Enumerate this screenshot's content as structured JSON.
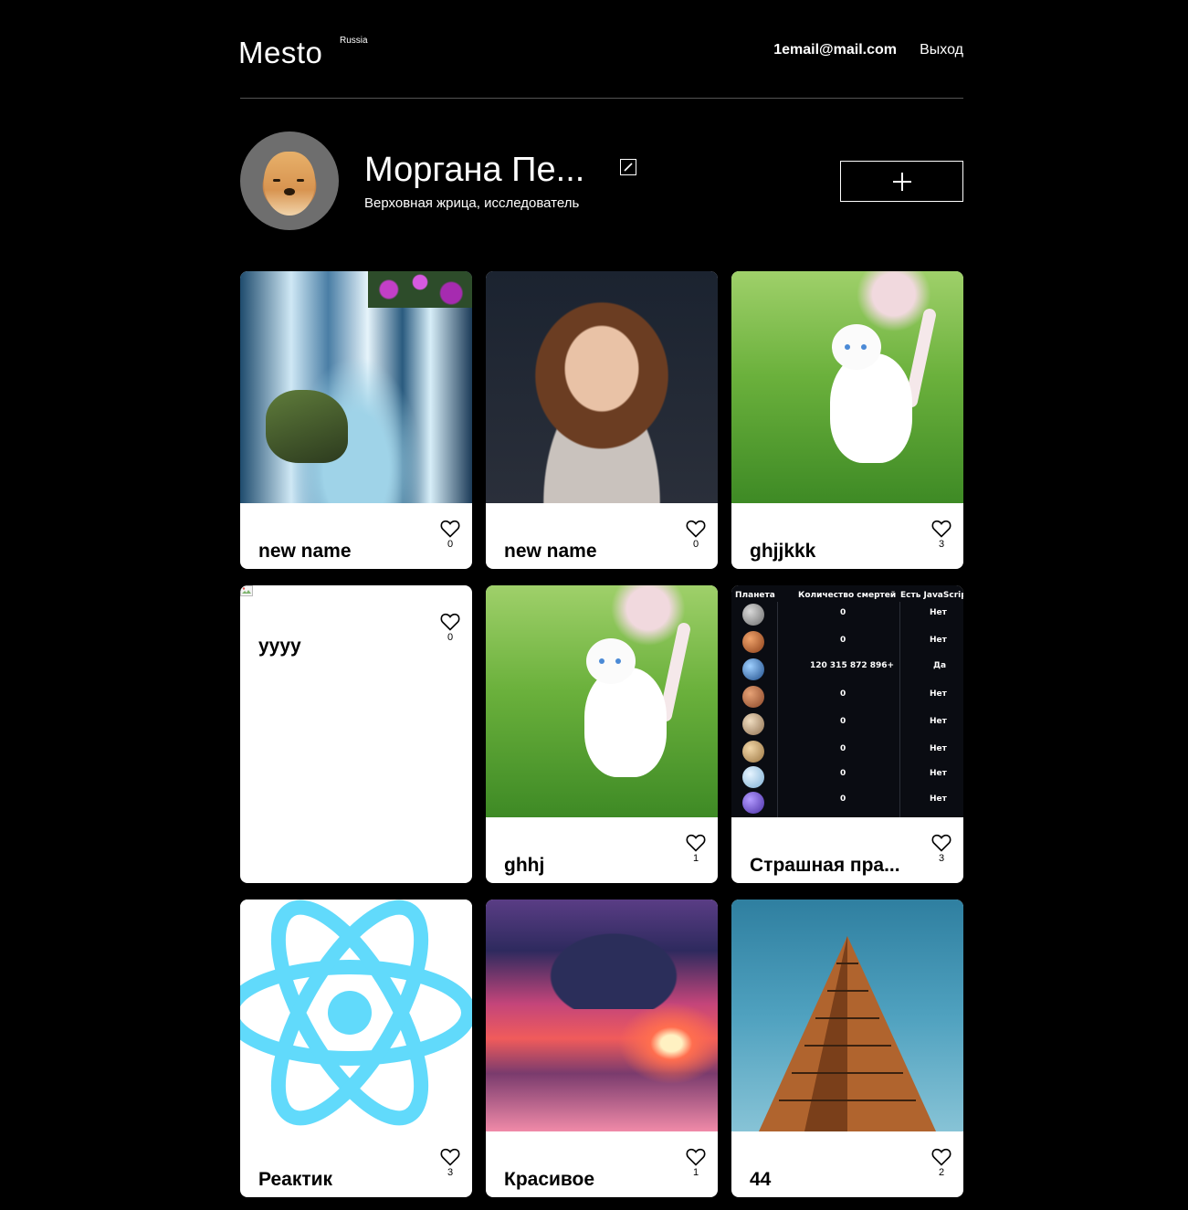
{
  "header": {
    "logo": "Mesto",
    "logo_sub": "Russia",
    "email": "1email@mail.com",
    "logout_label": "Выход"
  },
  "profile": {
    "name": "Моргана Пе...",
    "about": "Верховная жрица, исследователь"
  },
  "icons": {
    "edit": "pencil-icon",
    "add": "plus-icon",
    "like": "heart-icon"
  },
  "cards": [
    {
      "title": "new name",
      "likes": "0"
    },
    {
      "title": "new name",
      "likes": "0"
    },
    {
      "title": "ghjjkkk",
      "likes": "3"
    },
    {
      "title": "yyyy",
      "likes": "0"
    },
    {
      "title": "ghhj",
      "likes": "1"
    },
    {
      "title": "Страшная пра...",
      "likes": "3"
    },
    {
      "title": "Реактик",
      "likes": "3"
    },
    {
      "title": "Красивое",
      "likes": "1"
    },
    {
      "title": "44",
      "likes": "2"
    }
  ],
  "planet_table": {
    "headers": [
      "Планета",
      "Количество смертей",
      "Есть JavaScript"
    ],
    "rows": [
      {
        "deaths": "0",
        "js": "Нет"
      },
      {
        "deaths": "0",
        "js": "Нет"
      },
      {
        "deaths": "120 315 872 896+",
        "js": "Да"
      },
      {
        "deaths": "0",
        "js": "Нет"
      },
      {
        "deaths": "0",
        "js": "Нет"
      },
      {
        "deaths": "0",
        "js": "Нет"
      },
      {
        "deaths": "0",
        "js": "Нет"
      },
      {
        "deaths": "0",
        "js": "Нет"
      }
    ]
  },
  "colors": {
    "background": "#000000",
    "card": "#ffffff",
    "divider": "#545454",
    "react_blue": "#61dafb"
  }
}
